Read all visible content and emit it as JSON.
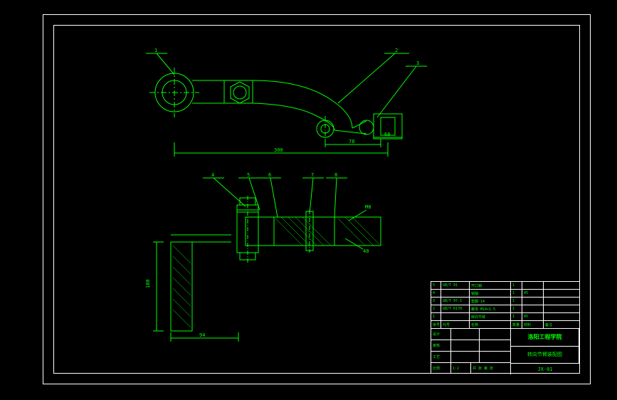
{
  "drawing": {
    "top_view": {
      "balloons": [
        {
          "num": "1",
          "leader_at": "left-arm"
        },
        {
          "num": "2",
          "leader_at": "right-arm-top"
        },
        {
          "num": "3",
          "leader_at": "right-arm-end"
        }
      ],
      "dimensions": {
        "overall_length": "300",
        "right_span": "78",
        "right_offset": "68"
      }
    },
    "section_view": {
      "balloons": [
        {
          "num": "4"
        },
        {
          "num": "5"
        },
        {
          "num": "6"
        },
        {
          "num": "7"
        },
        {
          "num": "8"
        }
      ],
      "dimensions": {
        "height_left": "180",
        "width_bottom": "94",
        "note_top_r": "M8",
        "note_r": "40"
      }
    }
  },
  "title_block": {
    "parts": [
      {
        "no": "1",
        "name": "转向节臂",
        "qty": "1",
        "mat": "45",
        "note": ""
      },
      {
        "no": "2",
        "name": "螺母 M14×1.5",
        "qty": "1",
        "mat": "",
        "note": "GB/T 6170"
      },
      {
        "no": "3",
        "name": "垫圈 14",
        "qty": "1",
        "mat": "",
        "note": "GB/T 97.1"
      },
      {
        "no": "4",
        "name": "销轴",
        "qty": "1",
        "mat": "45",
        "note": ""
      },
      {
        "no": "5",
        "name": "开口销",
        "qty": "1",
        "mat": "",
        "note": "GB/T 91"
      }
    ],
    "header": {
      "c1": "序号",
      "c2": "代号",
      "c3": "名称",
      "c4": "数量",
      "c5": "材料",
      "c6": "备注"
    },
    "school": "洛阳工程学院",
    "drawing_name": "转向节臂装配图",
    "drawing_no": "JX-01",
    "scale_label": "比例",
    "scale": "1:2",
    "sheet_label": "共 张 第 张",
    "designer_label": "设计",
    "checker_label": "审核",
    "approver_label": "工艺"
  }
}
